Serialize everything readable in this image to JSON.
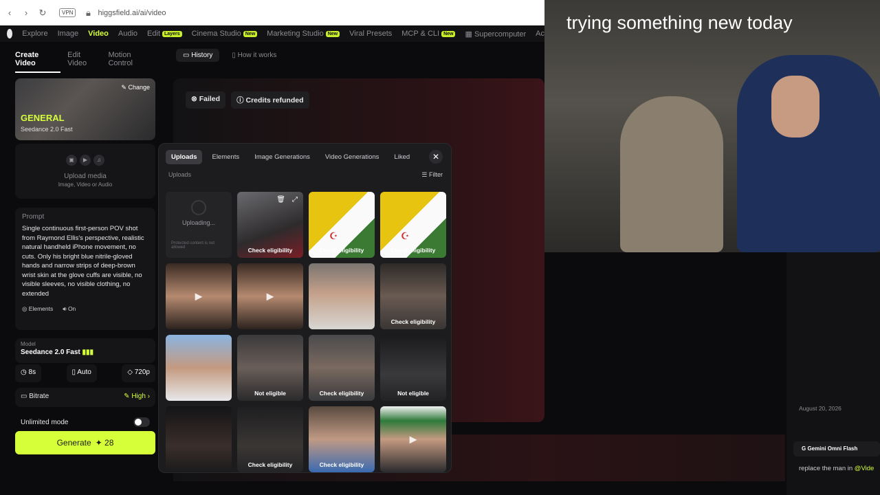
{
  "browser": {
    "url": "higgsfield.ai/ai/video",
    "vpn_label": "VPN"
  },
  "topnav": {
    "items": [
      "Explore",
      "Image",
      "Video",
      "Audio",
      "Edit",
      "Cinema Studio",
      "Marketing Studio",
      "Viral Presets",
      "MCP & CLI",
      "Supercomputer",
      "Ac"
    ],
    "active": "Video",
    "tags": {
      "edit": "Layers",
      "cinema": "New",
      "marketing": "New",
      "mcp": "New"
    }
  },
  "sidebar": {
    "tabs": [
      "Create Video",
      "Edit Video",
      "Motion Control"
    ],
    "model_card": {
      "name": "GENERAL",
      "subtitle": "Seedance 2.0 Fast",
      "change": "Change"
    },
    "upload": {
      "title": "Upload media",
      "subtitle": "Image, Video or Audio"
    },
    "prompt": {
      "label": "Prompt",
      "text": "Single continuous first-person POV shot from Raymond Ellis's perspective, realistic natural handheld iPhone movement, no cuts. Only his bright blue nitrile-gloved hands and narrow strips of deep-brown wrist skin at the glove cuffs are visible, no visible sleeves, no visible clothing, no extended",
      "elements": "Elements",
      "audio": "On"
    },
    "model": {
      "label": "Model",
      "value": "Seedance 2.0 Fast"
    },
    "chips": {
      "duration": "8s",
      "aspect": "Auto",
      "resolution": "720p"
    },
    "bitrate": {
      "label": "Bitrate",
      "value": "High"
    },
    "unlimited": "Unlimited mode",
    "generate": {
      "label": "Generate",
      "cost": "✦ 28"
    }
  },
  "history": {
    "tabs": [
      "History",
      "How it works"
    ],
    "status": "Failed",
    "credits": "Credits refunded"
  },
  "modal": {
    "tabs": [
      "Uploads",
      "Elements",
      "Image Generations",
      "Video Generations",
      "Liked"
    ],
    "section": "Uploads",
    "filter": "Filter",
    "uploading": "Uploading...",
    "protected": "Protected content is not allowed",
    "cells": [
      {
        "label": "",
        "type": "uploading"
      },
      {
        "label": "Check eligibility",
        "type": "video"
      },
      {
        "label": "Check eligibility",
        "type": "flag"
      },
      {
        "label": "Check eligibility",
        "type": "flag"
      },
      {
        "label": "",
        "type": "face-play"
      },
      {
        "label": "",
        "type": "face-play"
      },
      {
        "label": "",
        "type": "face"
      },
      {
        "label": "Check eligibility",
        "type": "face-dim"
      },
      {
        "label": "",
        "type": "selfie"
      },
      {
        "label": "Not eligible",
        "type": "sunglasses"
      },
      {
        "label": "Check eligibility",
        "type": "sunglasses"
      },
      {
        "label": "Not eligible",
        "type": "car-dark"
      },
      {
        "label": "",
        "type": "car-couple"
      },
      {
        "label": "Check eligibility",
        "type": "car-dark"
      },
      {
        "label": "Check eligibility",
        "type": "girl"
      },
      {
        "label": "",
        "type": "cap-play"
      }
    ]
  },
  "webcam": {
    "overlay_text": "trying something new today"
  },
  "right": {
    "date": "August 20, 2026",
    "model_badge": "Gemini Omni Flash",
    "prompt_snippet": "replace the man in ",
    "mention": "@Vide"
  }
}
